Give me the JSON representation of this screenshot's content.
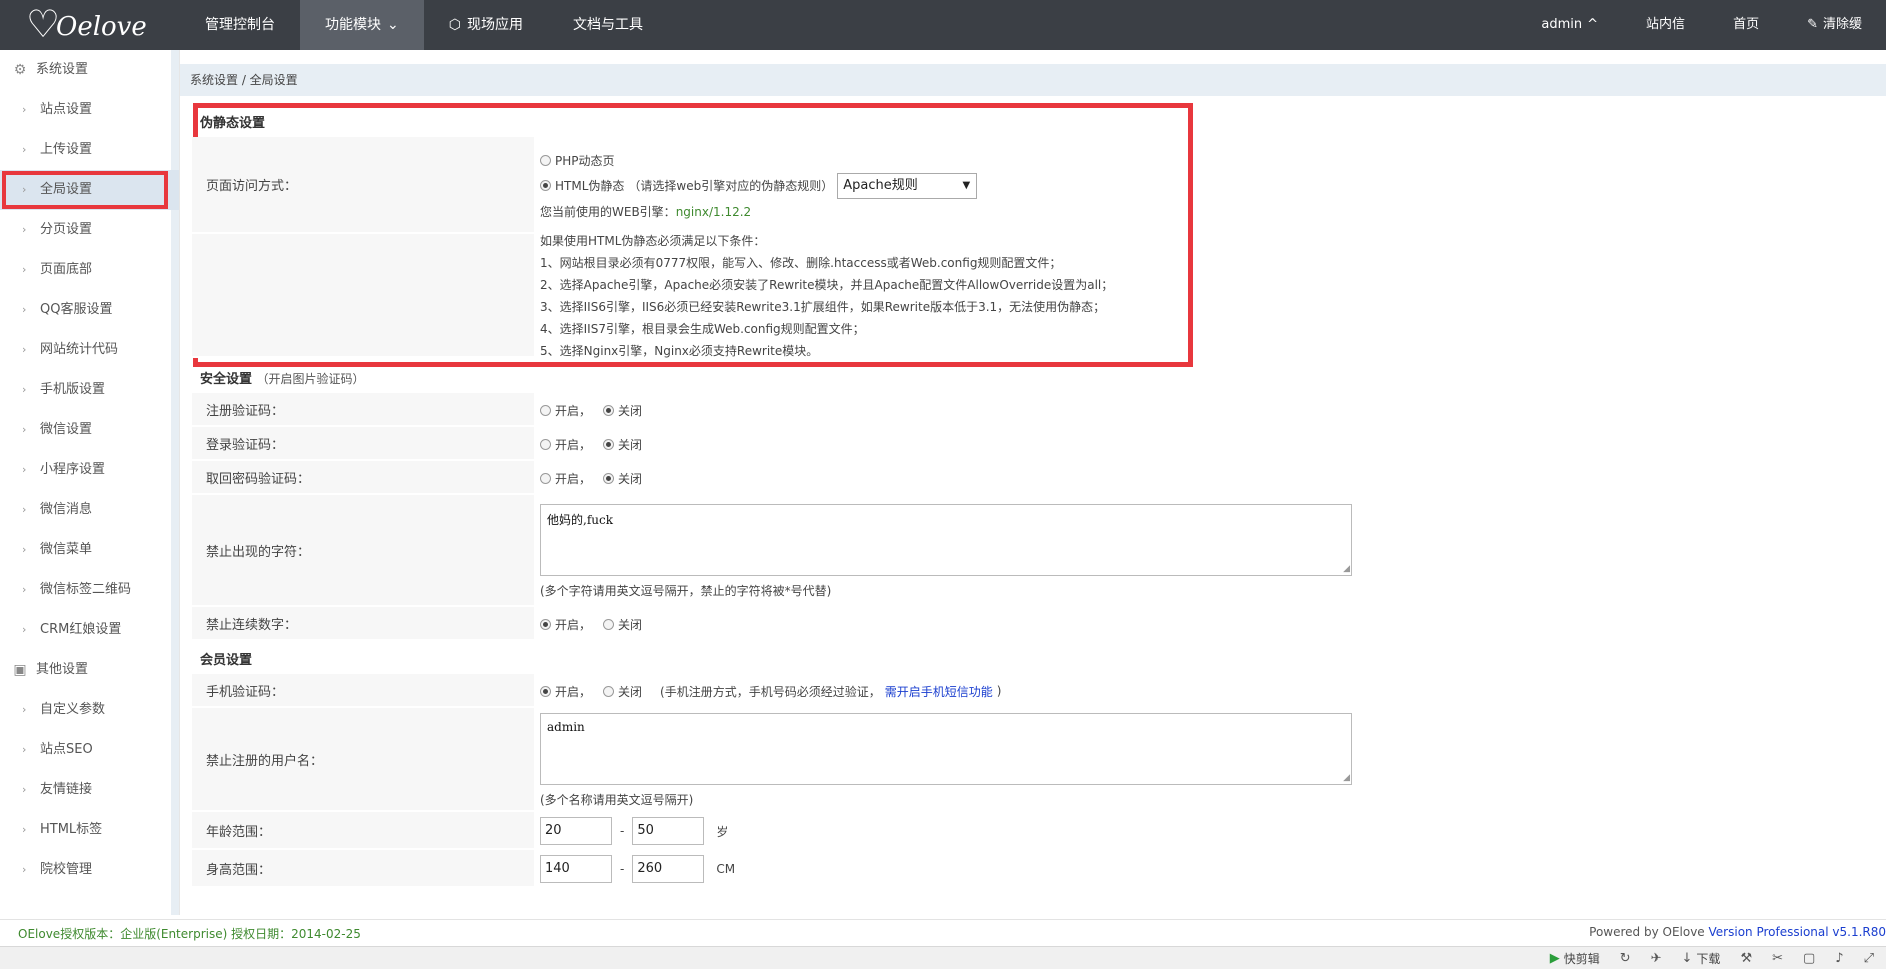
{
  "brand": {
    "logo_text": "Oelove"
  },
  "topnav": {
    "items": [
      {
        "label": "管理控制台"
      },
      {
        "label": "功能模块"
      },
      {
        "label": "现场应用"
      },
      {
        "label": "文档与工具"
      }
    ]
  },
  "topright": {
    "user": "admin",
    "messages": "站内信",
    "home": "首页",
    "clear": "清除缓"
  },
  "sidebar": {
    "group1": "系统设置",
    "items1": [
      "站点设置",
      "上传设置",
      "全局设置",
      "分页设置",
      "页面底部",
      "QQ客服设置",
      "网站统计代码",
      "手机版设置",
      "微信设置",
      "小程序设置",
      "微信消息",
      "微信菜单",
      "微信标签二维码",
      "CRM红娘设置"
    ],
    "group2": "其他设置",
    "items2": [
      "自定义参数",
      "站点SEO",
      "友情链接",
      "HTML标签",
      "院校管理"
    ]
  },
  "breadcrumb": "系统设置 / 全局设置",
  "static_section": {
    "title": "伪静态设置",
    "label": "页面访问方式：",
    "opt_php": "PHP动态页",
    "opt_html": "HTML伪静态",
    "opt_html_hint": "（请选择web引擎对应的伪静态规则）",
    "engine_select": "Apache规则",
    "current_engine_label": "您当前使用的WEB引擎：",
    "current_engine": "nginx/1.12.2",
    "notes": [
      "如果使用HTML伪静态必须满足以下条件：",
      "1、网站根目录必须有0777权限，能写入、修改、删除.htaccess或者Web.config规则配置文件；",
      "2、选择Apache引擎，Apache必须安装了Rewrite模块，并且Apache配置文件AllowOverride设置为all；",
      "3、选择IIS6引擎，IIS6必须已经安装Rewrite3.1扩展组件，如果Rewrite版本低于3.1，无法使用伪静态；",
      "4、选择IIS7引擎，根目录会生成Web.config规则配置文件；",
      "5、选择Nginx引擎，Nginx必须支持Rewrite模块。"
    ]
  },
  "security_section": {
    "title": "安全设置",
    "subtitle": "（开启图片验证码）",
    "on": "开启，",
    "off": "关闭",
    "reg_captcha": "注册验证码：",
    "login_captcha": "登录验证码：",
    "pwd_captcha": "取回密码验证码：",
    "forbidden_chars_label": "禁止出现的字符：",
    "forbidden_chars_value": "他妈的,fuck",
    "forbidden_chars_hint": "(多个字符请用英文逗号隔开，禁止的字符将被*号代替)",
    "forbid_digits_label": "禁止连续数字："
  },
  "member_section": {
    "title": "会员设置",
    "mobile_captcha": "手机验证码：",
    "mobile_hint_pre": "(手机注册方式，手机号码必须经过验证，",
    "mobile_hint_link": "需开启手机短信功能",
    "mobile_hint_post": ")",
    "forbidden_users_label": "禁止注册的用户名：",
    "forbidden_users_value": "admin",
    "forbidden_users_hint": "(多个名称请用英文逗号隔开)",
    "age_label": "年龄范围：",
    "age_min": "20",
    "age_max": "50",
    "age_unit": "岁",
    "height_label": "身高范围：",
    "height_min": "140",
    "height_max": "260",
    "height_unit": "CM",
    "dash": "-"
  },
  "footer": {
    "license": "OElove授权版本：企业版(Enterprise) 授权日期：2014-02-25",
    "powered": "Powered by OElove ",
    "version": "Version Professional v5.1.R80"
  },
  "statusbar": {
    "quick_edit": "快剪辑",
    "download": "下载"
  }
}
